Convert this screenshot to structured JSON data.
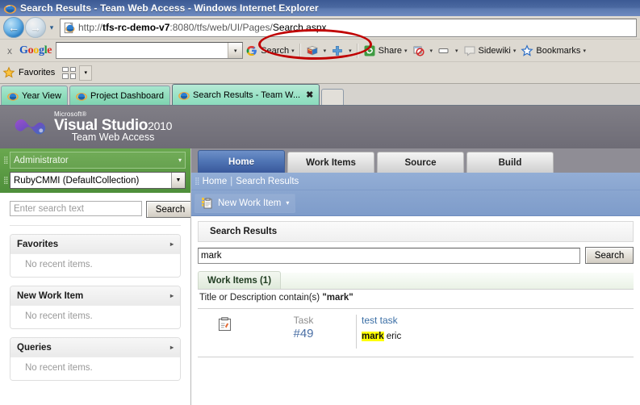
{
  "window": {
    "title": "Search Results - Team Web Access - Windows Internet Explorer"
  },
  "address_bar": {
    "url_scheme": "http://",
    "url_host": "tfs-rc-demo-v7",
    "url_port": ":8080",
    "url_path": "/tfs/web/UI/Pages/",
    "url_page": "Search.aspx",
    "back_arrow": "←",
    "forward_arrow": "→",
    "history_caret": "▾"
  },
  "google_toolbar": {
    "close": "x",
    "logo": [
      "G",
      "o",
      "o",
      "g",
      "l",
      "e"
    ],
    "search_value": "",
    "dropdown_caret": "▾",
    "items": [
      {
        "label": "Search",
        "icon": "google-g-icon",
        "caret": "▾"
      },
      {
        "label": "",
        "icon": "bookmarks-book-icon",
        "caret": "▾"
      },
      {
        "label": "",
        "icon": "plus-icon",
        "caret": "▾"
      },
      {
        "label": "Share",
        "icon": "share-icon",
        "caret": "▾"
      },
      {
        "label": "",
        "icon": "popup-blocker-icon",
        "caret": "▾"
      },
      {
        "label": "",
        "icon": "highlight-icon",
        "caret": "▾"
      },
      {
        "label": "Sidewiki",
        "icon": "sidewiki-icon",
        "caret": "▾"
      },
      {
        "label": "Bookmarks",
        "icon": "star-icon",
        "caret": "▾"
      }
    ]
  },
  "favorites_bar": {
    "label": "Favorites",
    "caret": "▾"
  },
  "tabs": [
    {
      "label": "Year View",
      "active": false,
      "closable": false
    },
    {
      "label": "Project Dashboard",
      "active": false,
      "closable": false
    },
    {
      "label": "Search Results - Team W...",
      "active": true,
      "closable": true,
      "close_glyph": "✖"
    }
  ],
  "tfs_header": {
    "microsoft": "Microsoft®",
    "product": "Visual Studio",
    "year": "2010",
    "subtitle": "Team Web Access"
  },
  "sidebar": {
    "user": "Administrator",
    "user_caret": "▾",
    "project": "RubyCMMI (DefaultCollection)",
    "project_caret": "▾",
    "search_placeholder": "Enter search text",
    "search_value": "",
    "search_button": "Search",
    "panels": [
      {
        "title": "Favorites",
        "chevron": "▸",
        "body": "No recent items."
      },
      {
        "title": "New Work Item",
        "chevron": "▸",
        "body": "No recent items."
      },
      {
        "title": "Queries",
        "chevron": "▸",
        "body": "No recent items."
      }
    ]
  },
  "nav_tabs": [
    {
      "label": "Home",
      "selected": true
    },
    {
      "label": "Work Items",
      "selected": false
    },
    {
      "label": "Source",
      "selected": false
    },
    {
      "label": "Build",
      "selected": false
    }
  ],
  "breadcrumb": {
    "home": "Home",
    "separator": "|",
    "current": "Search Results"
  },
  "command_bar": {
    "new_work_item": "New Work Item",
    "caret": "▾"
  },
  "search_results": {
    "panel_title": "Search Results",
    "query_value": "mark",
    "search_button": "Search",
    "result_tab": "Work Items (1)",
    "criteria_prefix": "Title or Description contain(s) ",
    "criteria_term": "\"mark\"",
    "rows": [
      {
        "icon": "task-work-item-icon",
        "type": "Task",
        "id": "#49",
        "title": "test task",
        "desc_highlight": "mark",
        "desc_rest": " eric"
      }
    ]
  },
  "colors": {
    "title_bar": "#4a68a0",
    "tfs_header": "#76747d",
    "sidebar_green": "#5c9a45",
    "nav_selected": "#4f74b4",
    "breadcrumb": "#8fabd4",
    "tab_green": "#8fdcbb",
    "highlight": "#ffff00",
    "annotation_red": "#c00000",
    "link_blue": "#3a6ea5"
  }
}
